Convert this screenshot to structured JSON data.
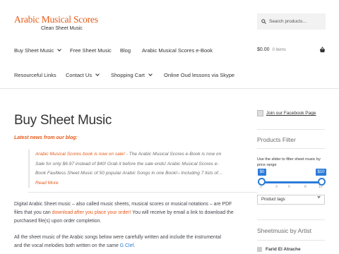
{
  "header": {
    "logo_title": "Arabic Musical Scores",
    "logo_subtitle": "Clean Sheet Music",
    "search_placeholder": "Search products…"
  },
  "nav": {
    "items": [
      {
        "label": "Buy Sheet Music",
        "dropdown": true
      },
      {
        "label": "Free Sheet Music",
        "dropdown": false
      },
      {
        "label": "Blog",
        "dropdown": false
      },
      {
        "label": "Arabic Musical Scores e-Book",
        "dropdown": false
      },
      {
        "label": "Resourceful Links",
        "dropdown": false
      },
      {
        "label": "Contact Us",
        "dropdown": true
      },
      {
        "label": "Shopping Cart",
        "dropdown": true
      },
      {
        "label": "Online Oud lessons via Skype",
        "dropdown": false
      }
    ]
  },
  "cart": {
    "amount": "$0.00",
    "items": "0 items"
  },
  "main": {
    "title": "Buy Sheet Music",
    "latest": "Latest news from our blog:",
    "quote_lines": [
      "Arabic Musical Scores book is now on sale! - The Arabic Musical Scores e-Book is now on",
      "Sale for only $6.97 instead of $40! Grab it before the sale ends! Arabic Musical Scores e-",
      "Book Faultless Sheet Music of 50 popular Arabic Songs in one Book!– Including 7 lists of…"
    ],
    "quote_link": "Arabic Musical Scores book is now on sale!",
    "quote_line1_rest": " - The Arabic Musical Scores e-Book is now on",
    "read_more": "Read More",
    "p1_line1": "Digital Arabic Sheet music – also called music sheets, musical scores or musical notations – are PDF",
    "p1_line2_pre": "files that you can ",
    "p1_line2_link": "download after you place your order!",
    "p1_line2_post": " You will receive by email a link to download the",
    "p1_line3": "purchased file(s) upon order completion.",
    "p2_line1": "All the sheet music of the Arabic songs below were carefully written and include the instrumental",
    "p2_line2_pre": "and the vocal melodies both written on the same ",
    "p2_line2_link": "G Clef",
    "p2_line2_post": "."
  },
  "sidebar": {
    "facebook": "Join our Facebook Page",
    "filter_title": "Products Filter",
    "slider_hint": "Use the slider to filter sheet music by price range",
    "price_min": "$0",
    "price_max": "$10",
    "slider_min_value": 0,
    "slider_max_value": 10,
    "ticks": [
      "0",
      "3",
      "5",
      "8",
      "10"
    ],
    "select_value": "Product tags",
    "artist_title": "Sheetmusic by Artist",
    "artist_first": "Farid El Atrache"
  },
  "colors": {
    "accent": "#e65a19",
    "link_blue": "#2a7bd8",
    "slider": "#2a7bd8"
  }
}
